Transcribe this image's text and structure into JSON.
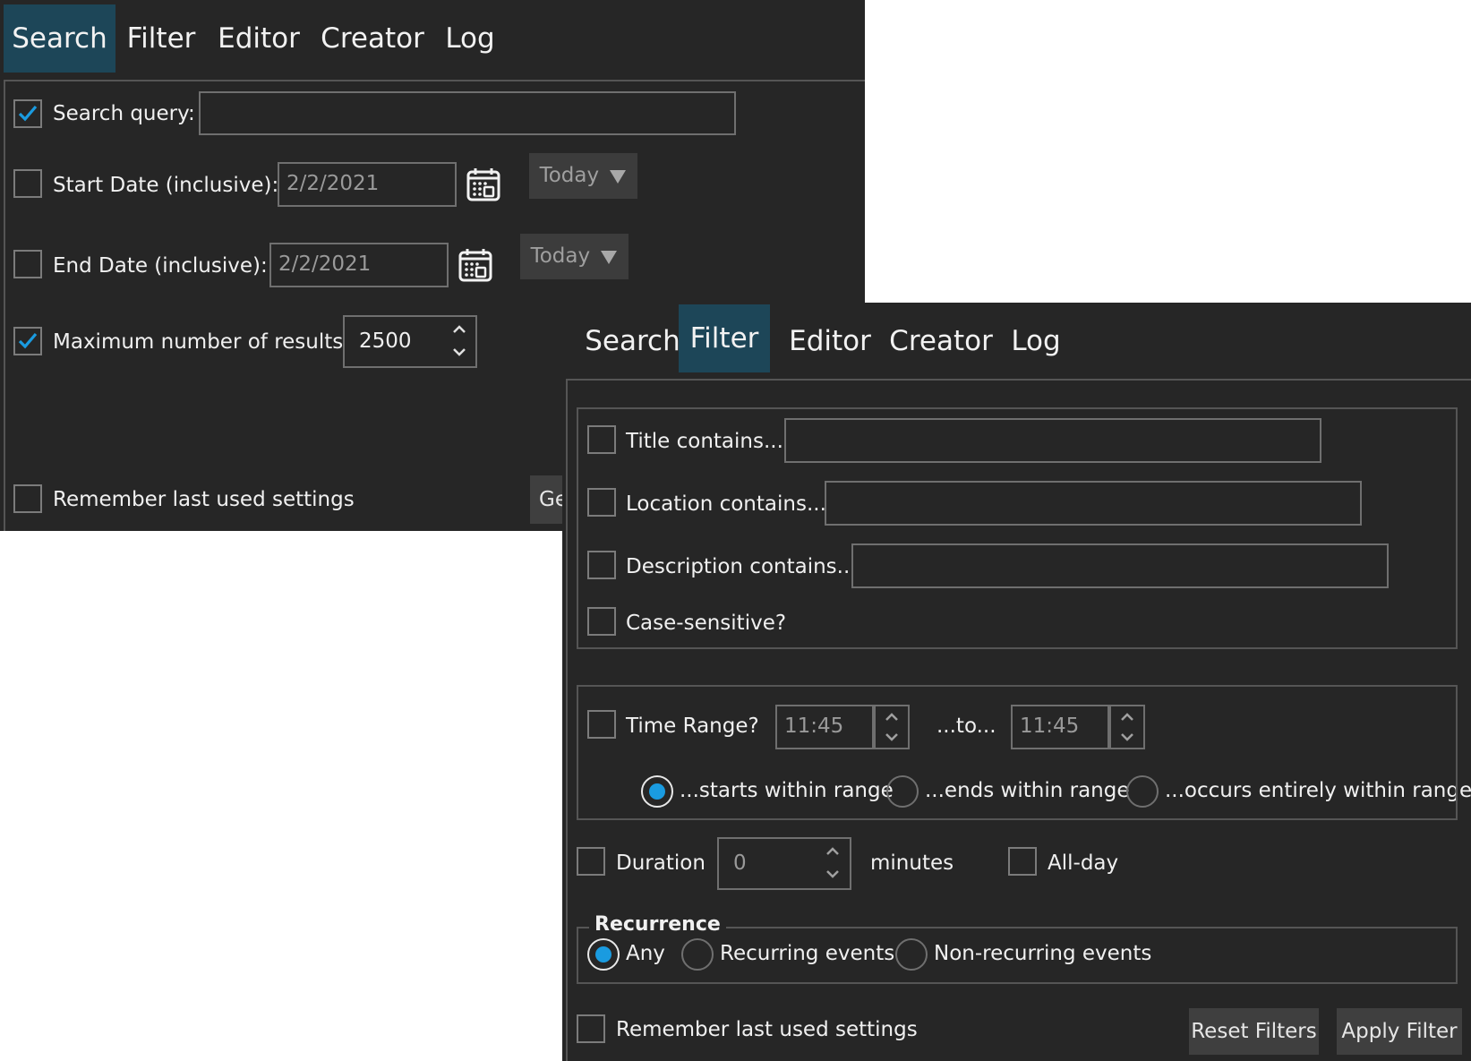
{
  "tabs": [
    "Search",
    "Filter",
    "Editor",
    "Creator",
    "Log"
  ],
  "search_window": {
    "active_tab": "Search",
    "search_query": {
      "label": "Search query:",
      "checked": true,
      "value": ""
    },
    "start_date": {
      "label": "Start Date (inclusive):",
      "checked": false,
      "value": "2/2/2021",
      "today_button": "Today"
    },
    "end_date": {
      "label": "End Date (inclusive):",
      "checked": false,
      "value": "2/2/2021",
      "today_button": "Today"
    },
    "max_results": {
      "label": "Maximum number of results:",
      "checked": true,
      "value": "2500"
    },
    "remember": {
      "label": "Remember last used settings",
      "checked": false
    },
    "go_button_partial": "Ge"
  },
  "filter_window": {
    "active_tab": "Filter",
    "title_contains": {
      "label": "Title contains...",
      "checked": false,
      "value": ""
    },
    "location_contains": {
      "label": "Location contains...",
      "checked": false,
      "value": ""
    },
    "description_contains": {
      "label": "Description contains...",
      "checked": false,
      "value": ""
    },
    "case_sensitive": {
      "label": "Case-sensitive?",
      "checked": false
    },
    "time_range": {
      "label": "Time Range?",
      "checked": false,
      "from": "11:45",
      "to_label": "...to...",
      "to": "11:45",
      "modes": [
        "...starts within range",
        "...ends within range",
        "...occurs entirely within range"
      ],
      "selected_mode": 0
    },
    "duration": {
      "label": "Duration",
      "checked": false,
      "value": "0",
      "unit": "minutes"
    },
    "all_day": {
      "label": "All-day",
      "checked": false
    },
    "recurrence": {
      "title": "Recurrence",
      "options": [
        "Any",
        "Recurring events",
        "Non-recurring events"
      ],
      "selected": 0
    },
    "remember": {
      "label": "Remember last used settings",
      "checked": false
    },
    "reset_button": "Reset Filters",
    "apply_button": "Apply Filter"
  },
  "colors": {
    "background": "#262626",
    "accent": "#1a9be0",
    "active_tab": "#1d4658"
  },
  "icons": [
    "check-icon",
    "calendar-icon",
    "dropdown-arrow-icon",
    "spin-up-icon",
    "spin-down-icon"
  ]
}
